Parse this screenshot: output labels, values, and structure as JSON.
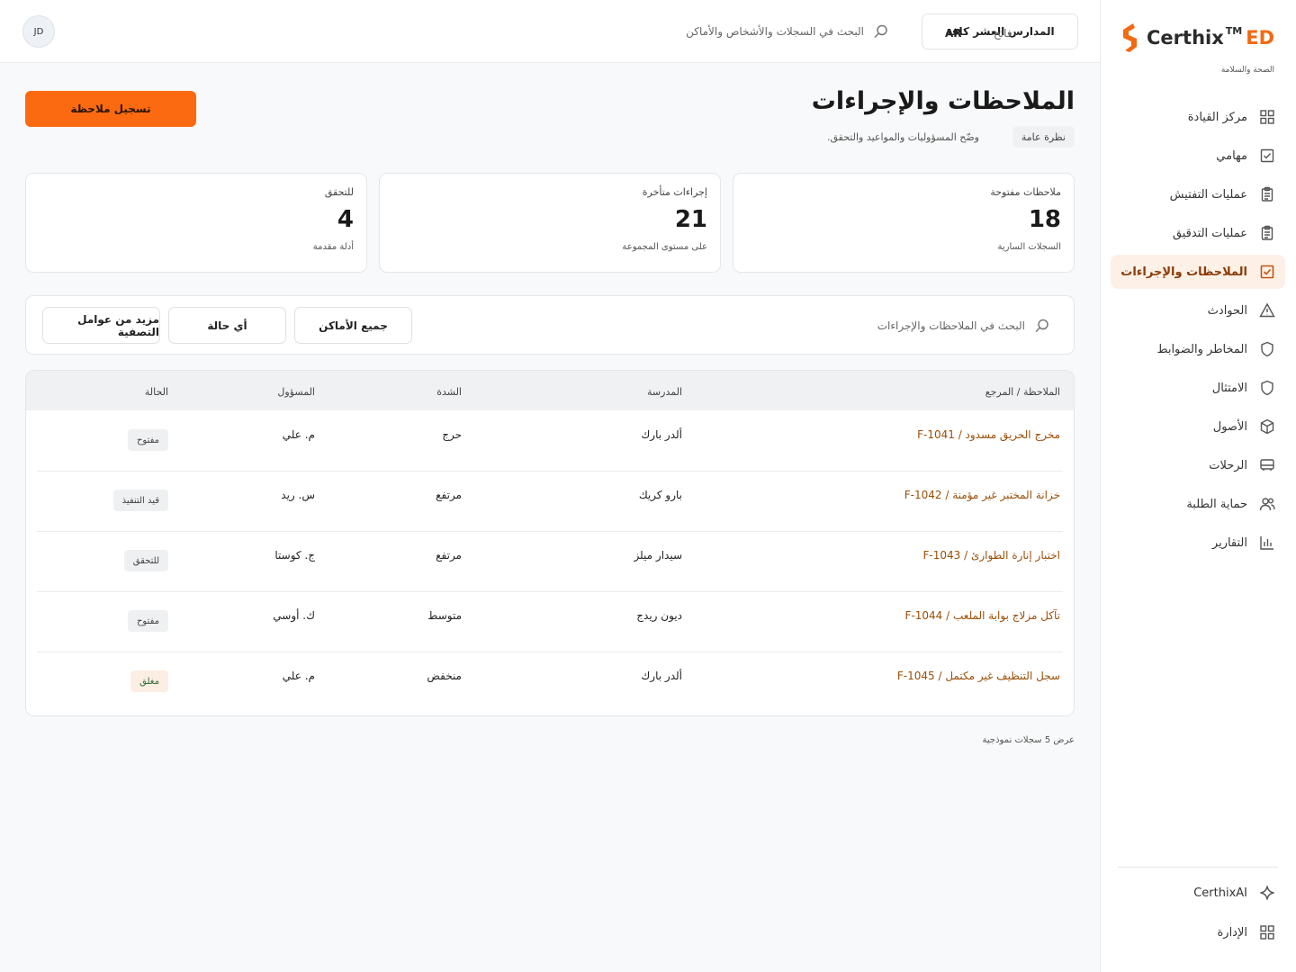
{
  "brand": {
    "name": "Certhix",
    "tm": "TM",
    "suffix": "ED",
    "tagline": "الصحة والسلامة",
    "accent": "#f26a12"
  },
  "sidebar": {
    "items": [
      {
        "label": "مركز القيادة",
        "icon": "grid-icon"
      },
      {
        "label": "مهامي",
        "icon": "checkbox-icon"
      },
      {
        "label": "عمليات التفتيش",
        "icon": "clipboard-icon"
      },
      {
        "label": "عمليات التدقيق",
        "icon": "clipboard-list-icon"
      },
      {
        "label": "الملاحظات والإجراءات",
        "icon": "check-square-icon",
        "active": true
      },
      {
        "label": "الحوادث",
        "icon": "warning-triangle-icon"
      },
      {
        "label": "المخاطر والضوابط",
        "icon": "shield-icon"
      },
      {
        "label": "الامتثال",
        "icon": "shield-outline-icon"
      },
      {
        "label": "الأصول",
        "icon": "cube-icon"
      },
      {
        "label": "الرحلات",
        "icon": "bus-icon"
      },
      {
        "label": "حماية الطلبة",
        "icon": "users-icon"
      },
      {
        "label": "التقارير",
        "icon": "bar-chart-icon"
      }
    ],
    "footer": [
      {
        "label": "CerthixAI",
        "icon": "sparkle-icon"
      },
      {
        "label": "الإدارة",
        "icon": "grid-icon"
      }
    ]
  },
  "topbar": {
    "scope": "المدارس العشر كافة",
    "search_placeholder": "البحث في السجلات والأشخاص والأماكن",
    "language": "AR",
    "theme": "فاتح",
    "avatar": "JD"
  },
  "page": {
    "title": "الملاحظات والإجراءات",
    "chip": "نظرة عامة",
    "subtitle": "وضّح المسؤوليات والمواعيد والتحقق.",
    "primary_action": "تسجيل ملاحظة"
  },
  "kpis": [
    {
      "label": "ملاحظات مفتوحة",
      "value": "18",
      "sub": "السجلات السارية"
    },
    {
      "label": "إجراءات متأخرة",
      "value": "21",
      "sub": "على مستوى المجموعة"
    },
    {
      "label": "للتحقق",
      "value": "4",
      "sub": "أدلة مقدمة"
    }
  ],
  "filters": {
    "search_placeholder": "البحث في الملاحظات والإجراءات",
    "locations": "جميع الأماكن",
    "status": "أي حالة",
    "more": "مزيد من عوامل التصفية"
  },
  "table": {
    "columns": [
      "الملاحظة / المرجع",
      "المدرسة",
      "الشدة",
      "المسؤول",
      "الحالة"
    ],
    "rows": [
      {
        "ref": "مخرج الحريق مسدود / F-1041",
        "school": "ألدر بارك",
        "severity": "حرج",
        "owner": "م. علي",
        "status": "مفتوح"
      },
      {
        "ref": "خزانة المختبر غير مؤمنة / F-1042",
        "school": "بارو كريك",
        "severity": "مرتفع",
        "owner": "س. ريد",
        "status": "قيد التنفيذ"
      },
      {
        "ref": "اختبار إنارة الطوارئ / F-1043",
        "school": "سيدار ميلز",
        "severity": "مرتفع",
        "owner": "ج. كوستا",
        "status": "للتحقق"
      },
      {
        "ref": "تآكل مزلاج بوابة الملعب / F-1044",
        "school": "ديون ريدج",
        "severity": "متوسط",
        "owner": "ك. أوسي",
        "status": "مفتوح"
      },
      {
        "ref": "سجل التنظيف غير مكتمل / F-1045",
        "school": "ألدر بارك",
        "severity": "منخفض",
        "owner": "م. علي",
        "status": "مغلق"
      }
    ]
  },
  "footer_note": "عرض 5 سجلات نموذجية"
}
